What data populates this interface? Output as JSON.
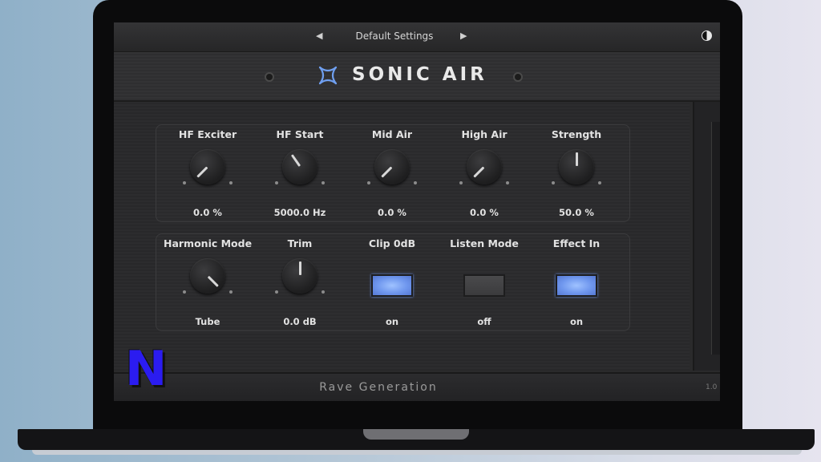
{
  "topbar": {
    "preset_name": "Default Settings",
    "prev_arrow": "◀",
    "next_arrow": "▶"
  },
  "header": {
    "title": "SONIC AIR",
    "logo_icon": "sonic-air-logo"
  },
  "row1": [
    {
      "label": "HF Exciter",
      "value": "0.0 %",
      "angle": -135
    },
    {
      "label": "HF Start",
      "value": "5000.0 Hz",
      "angle": -35
    },
    {
      "label": "Mid Air",
      "value": "0.0 %",
      "angle": -135
    },
    {
      "label": "High Air",
      "value": "0.0 %",
      "angle": -135
    },
    {
      "label": "Strength",
      "value": "50.0 %",
      "angle": 0
    }
  ],
  "row2": [
    {
      "label": "Harmonic Mode",
      "value": "Tube",
      "type": "knob",
      "angle": 135
    },
    {
      "label": "Trim",
      "value": "0.0 dB",
      "type": "knob",
      "angle": 0
    },
    {
      "label": "Clip 0dB",
      "value": "on",
      "type": "button",
      "state": "on"
    },
    {
      "label": "Listen Mode",
      "value": "off",
      "type": "button",
      "state": "off"
    },
    {
      "label": "Effect In",
      "value": "on",
      "type": "button",
      "state": "on"
    }
  ],
  "footer": {
    "brand": "Rave Generation",
    "version": "1.0"
  },
  "watermark": "N",
  "colors": {
    "accent_on": "#7aa0f5",
    "background": "#2a2a2b"
  }
}
